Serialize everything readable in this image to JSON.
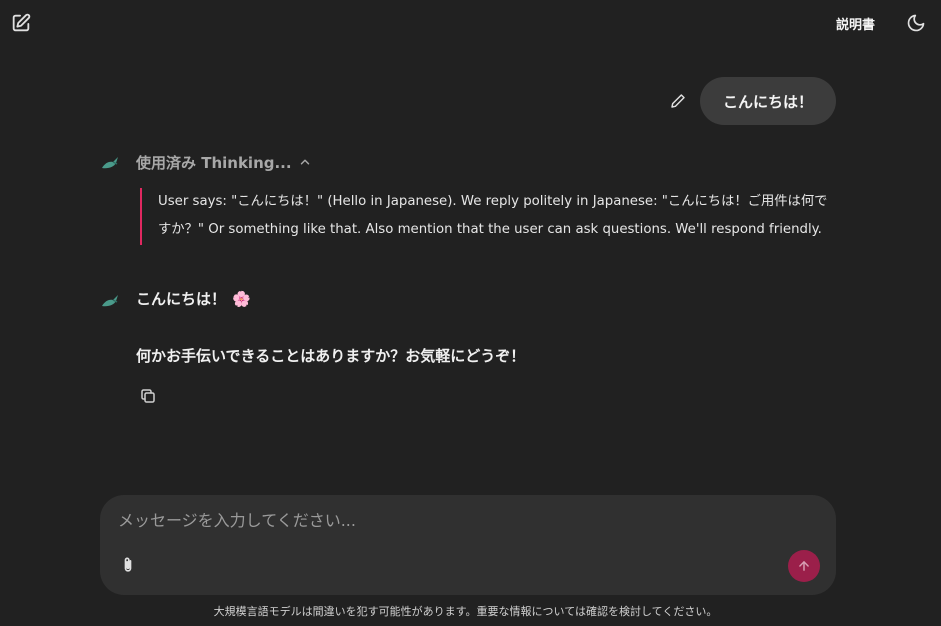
{
  "header": {
    "new_chat_icon": "edit-square-icon",
    "manual_label": "説明書",
    "theme_icon": "moon-icon"
  },
  "conversation": {
    "user_message": "こんにちは！",
    "edit_icon": "pencil-icon",
    "thinking": {
      "label": "使用済み Thinking...",
      "toggle_icon": "chevron-up-icon",
      "content": "User says: \"こんにちは！\" (Hello in Japanese). We reply politely in Japanese: \"こんにちは！ご用件は何ですか？\" Or something like that. Also mention that the user can ask questions. We'll respond friendly."
    },
    "assistant_reply": {
      "line1": "こんにちは！",
      "emoji": "🌸",
      "line2": "何かお手伝いできることはありますか？お気軽にどうぞ！"
    },
    "copy_icon": "copy-icon"
  },
  "composer": {
    "placeholder": "メッセージを入力してください...",
    "value": "",
    "attach_icon": "paperclip-icon",
    "send_icon": "arrow-up-icon"
  },
  "footer": {
    "disclaimer": "大規模言語モデルは間違いを犯す可能性があります。重要な情報については確認を検討してください。"
  },
  "colors": {
    "background": "#212121",
    "user_bubble": "#3c3c3c",
    "composer": "#303030",
    "accent": "#e02860",
    "send_button": "#9b1f4a",
    "avatar": "#4a9a8a"
  }
}
